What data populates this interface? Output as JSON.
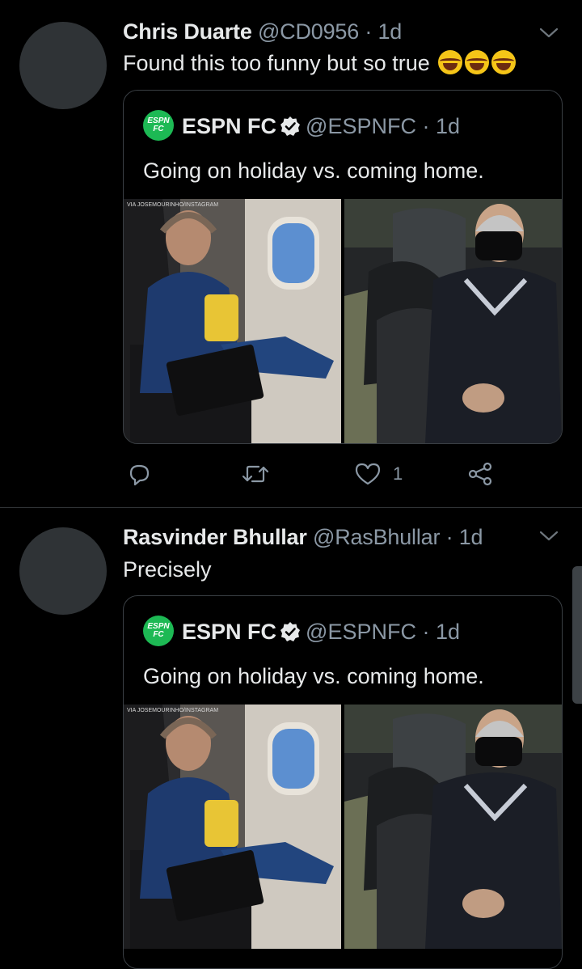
{
  "tweets": [
    {
      "name": "Chris Duarte",
      "handle": "@CD0956",
      "separator": "·",
      "time": "1d",
      "text": "Found this too funny but so true",
      "emojis": [
        "face-with-tears-of-joy",
        "face-with-tears-of-joy",
        "face-with-tears-of-joy"
      ],
      "quote": {
        "logo_text": "ESPN FC",
        "name": "ESPN FC",
        "handle": "@ESPNFC",
        "separator": "·",
        "time": "1d",
        "text": "Going on holiday vs. coming home.",
        "watermark": "VIA JOSEMOURINHO/INSTAGRAM"
      },
      "actions": {
        "reply_count": "",
        "retweet_count": "",
        "like_count": "1",
        "share_count": ""
      }
    },
    {
      "name": "Rasvinder Bhullar",
      "handle": "@RasBhullar",
      "separator": "·",
      "time": "1d",
      "text": "Precisely",
      "quote": {
        "logo_text": "ESPN FC",
        "name": "ESPN FC",
        "handle": "@ESPNFC",
        "separator": "·",
        "time": "1d",
        "text": "Going on holiday vs. coming home.",
        "watermark": "VIA JOSEMOURINHO/INSTAGRAM"
      }
    }
  ],
  "colors": {
    "background": "#000000",
    "primary_text": "#e7e9ea",
    "secondary_text": "#8b98a5",
    "espn_green": "#1db954",
    "divider": "#2f3336"
  }
}
